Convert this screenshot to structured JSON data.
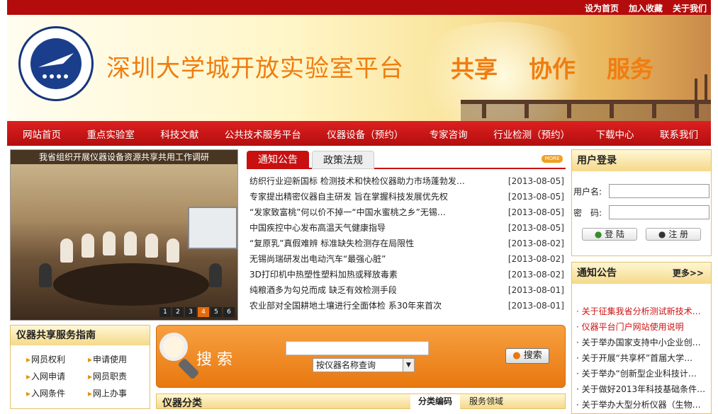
{
  "top_links": [
    "设为首页",
    "加入收藏",
    "关于我们"
  ],
  "site_title": "深圳大学城开放实验室平台",
  "slogan": [
    "共享",
    "协作",
    "服务"
  ],
  "nav": [
    "网站首页",
    "重点实验室",
    "科技文献",
    "公共技术服务平台",
    "仪器设备（预约）",
    "专家咨询",
    "行业检测（预约）",
    "下载中心",
    "联系我们"
  ],
  "slideshow": {
    "caption": "我省组织开展仪器设备资源共享共用工作调研",
    "pages": [
      "1",
      "2",
      "3",
      "4",
      "5",
      "6"
    ],
    "active": "4"
  },
  "news_tabs": [
    "通知公告",
    "政策法规"
  ],
  "more_badge": "MORE",
  "news": [
    {
      "title": "纺织行业迎新国标 检测技术和快检仪器助力市场蓬勃发…",
      "date": "[2013-08-05]"
    },
    {
      "title": "专家提出精密仪器自主研发 旨在掌握科技发展优先权",
      "date": "[2013-08-05]"
    },
    {
      "title": "“发家致富桃”何以价不掉一“中国水蜜桃之乡”无锡…",
      "date": "[2013-08-05]"
    },
    {
      "title": "中国疾控中心发布高温天气健康指导",
      "date": "[2013-08-05]"
    },
    {
      "title": "“复原乳”真假难辨 标准缺失检测存在局限性",
      "date": "[2013-08-02]"
    },
    {
      "title": "无锡尚瑞研发出电动汽车“最强心脏”",
      "date": "[2013-08-02]"
    },
    {
      "title": "3D打印机中热塑性塑料加热或释放毒素",
      "date": "[2013-08-02]"
    },
    {
      "title": "纯粮酒多为勾兑而成 缺乏有效检测手段",
      "date": "[2013-08-01]"
    },
    {
      "title": "农业部对全国耕地土壤进行全面体检 系30年来首次",
      "date": "[2013-08-01]"
    }
  ],
  "login": {
    "title": "用户登录",
    "user_label": "用户名:",
    "pass_label": "密　码:",
    "login_btn": "登 陆",
    "register_btn": "注 册"
  },
  "notice": {
    "title": "通知公告",
    "more": "更多>>",
    "items": [
      {
        "text": "关于征集我省分析测试新技术…",
        "red": true
      },
      {
        "text": "仪器平台门户网站使用说明",
        "red": true
      },
      {
        "text": "关于举办国家支持中小企业创…",
        "red": false
      },
      {
        "text": "关于开展“共享杯”首届大学…",
        "red": false
      },
      {
        "text": "关于举办“创新型企业科技计…",
        "red": false
      },
      {
        "text": "关于做好2013年科技基础条件…",
        "red": false
      },
      {
        "text": "关于举办大型分析仪器（生物…",
        "red": false
      }
    ]
  },
  "guide": {
    "title": "仪器共享服务指南",
    "items": [
      "网员权利",
      "申请使用",
      "入网申请",
      "网员职责",
      "入网条件",
      "网上办事"
    ]
  },
  "search": {
    "title": "搜 索",
    "select": "按仪器名称查询",
    "button": "搜索"
  },
  "category": {
    "title": "仪器分类",
    "tabs": [
      "分类编码",
      "服务领域"
    ]
  },
  "colors": {
    "brand_red": "#c81010",
    "orange": "#f07d10"
  }
}
